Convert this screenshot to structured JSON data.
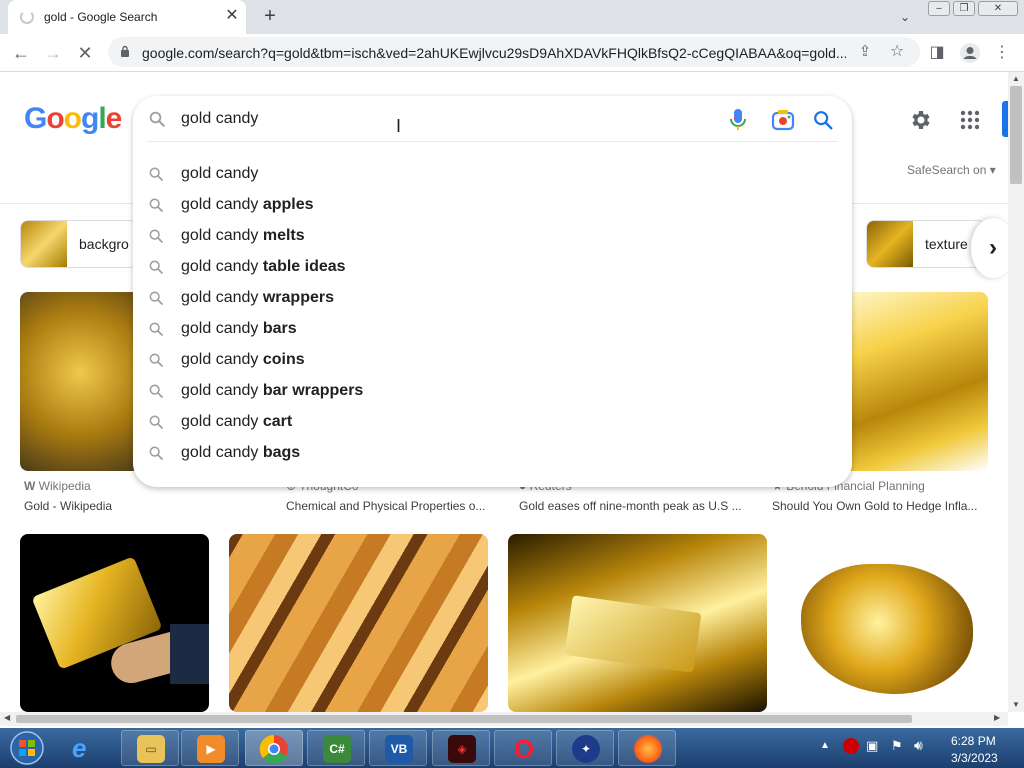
{
  "browser": {
    "tab_title": "gold - Google Search",
    "url": "google.com/search?q=gold&tbm=isch&ved=2ahUKEwjlvcu29sD9AhXDAVkFHQlkBfsQ2-cCegQIABAA&oq=gold..."
  },
  "google": {
    "logo": "Google",
    "safesearch": "SafeSearch on"
  },
  "search": {
    "value": "gold candy",
    "suggestions": [
      {
        "prefix": "gold candy",
        "bold": ""
      },
      {
        "prefix": "gold candy ",
        "bold": "apples"
      },
      {
        "prefix": "gold candy ",
        "bold": "melts"
      },
      {
        "prefix": "gold candy ",
        "bold": "table ideas"
      },
      {
        "prefix": "gold candy ",
        "bold": "wrappers"
      },
      {
        "prefix": "gold candy ",
        "bold": "bars"
      },
      {
        "prefix": "gold candy ",
        "bold": "coins"
      },
      {
        "prefix": "gold candy ",
        "bold": "bar wrappers"
      },
      {
        "prefix": "gold candy ",
        "bold": "cart"
      },
      {
        "prefix": "gold candy ",
        "bold": "bags"
      }
    ]
  },
  "chips": [
    {
      "label": "backgro"
    },
    {
      "label": "texture"
    }
  ],
  "results_row1": [
    {
      "source": "Wikipedia",
      "title": "Gold - Wikipedia"
    },
    {
      "source": "ThoughtCo",
      "title": "Chemical and Physical Properties o..."
    },
    {
      "source": "Reuters",
      "title": "Gold eases off nine-month peak as U.S ..."
    },
    {
      "source": "Behold Financial Planning",
      "title": "Should You Own Gold to Hedge Infla..."
    }
  ],
  "taskbar": {
    "time": "6:28 PM",
    "date": "3/3/2023",
    "apps": [
      "C#",
      "VB"
    ]
  },
  "colors": {
    "google_blue": "#4285f4",
    "google_red": "#ea4335",
    "google_yellow": "#fbbc05",
    "google_green": "#34a853",
    "gold": "#c9a227"
  }
}
